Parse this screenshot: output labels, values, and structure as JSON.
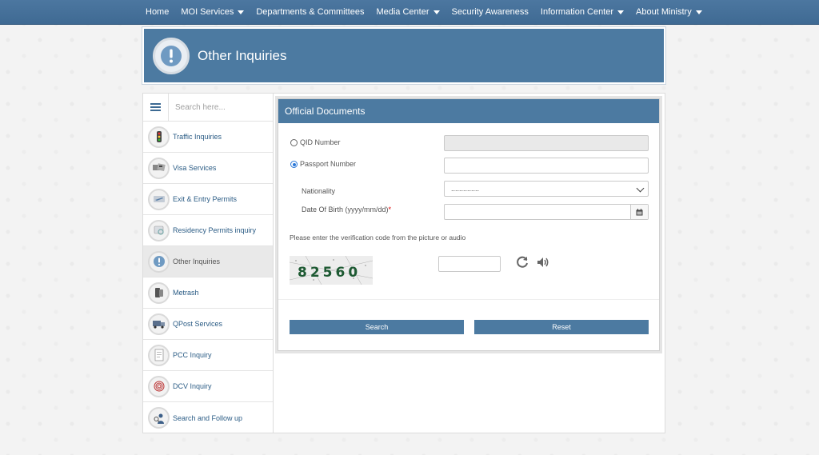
{
  "nav": {
    "items": [
      {
        "label": "Home",
        "dropdown": false
      },
      {
        "label": "MOI Services",
        "dropdown": true
      },
      {
        "label": "Departments & Committees",
        "dropdown": false
      },
      {
        "label": "Media Center",
        "dropdown": true
      },
      {
        "label": "Security Awareness",
        "dropdown": false
      },
      {
        "label": "Information Center",
        "dropdown": true
      },
      {
        "label": "About Ministry",
        "dropdown": true
      }
    ]
  },
  "banner": {
    "title": "Other Inquiries",
    "icon": "exclamation-icon"
  },
  "sidebar": {
    "search_placeholder": "Search here...",
    "items": [
      {
        "label": "Traffic Inquiries",
        "icon": "traffic-light-icon",
        "active": false
      },
      {
        "label": "Visa Services",
        "icon": "visa-icon",
        "active": false
      },
      {
        "label": "Exit & Entry Permits",
        "icon": "airplane-icon",
        "active": false
      },
      {
        "label": "Residency Permits inquiry",
        "icon": "residency-icon",
        "active": false
      },
      {
        "label": "Other Inquiries",
        "icon": "exclamation-icon",
        "active": true
      },
      {
        "label": "Metrash",
        "icon": "phone-icon",
        "active": false
      },
      {
        "label": "QPost Services",
        "icon": "truck-icon",
        "active": false
      },
      {
        "label": "PCC Inquiry",
        "icon": "document-icon",
        "active": false
      },
      {
        "label": "DCV Inquiry",
        "icon": "fingerprint-icon",
        "active": false
      },
      {
        "label": "Search and Follow up",
        "icon": "search-person-icon",
        "active": false
      }
    ]
  },
  "form": {
    "title": "Official Documents",
    "qid_label": "QID Number",
    "passport_label": "Passport Number",
    "passport_value": "",
    "nationality_label": "Nationality",
    "nationality_value": "..............",
    "dob_label": "Date Of Birth (yyyy/mm/dd)",
    "dob_required": "*",
    "verification_text": "Please enter the verification code from the picture or audio",
    "captcha_text": "82560",
    "search_button": "Search",
    "reset_button": "Reset",
    "selected_id_type": "passport"
  },
  "colors": {
    "primary": "#4c7aa1",
    "link": "#2b5c85",
    "required": "#dd0000"
  }
}
